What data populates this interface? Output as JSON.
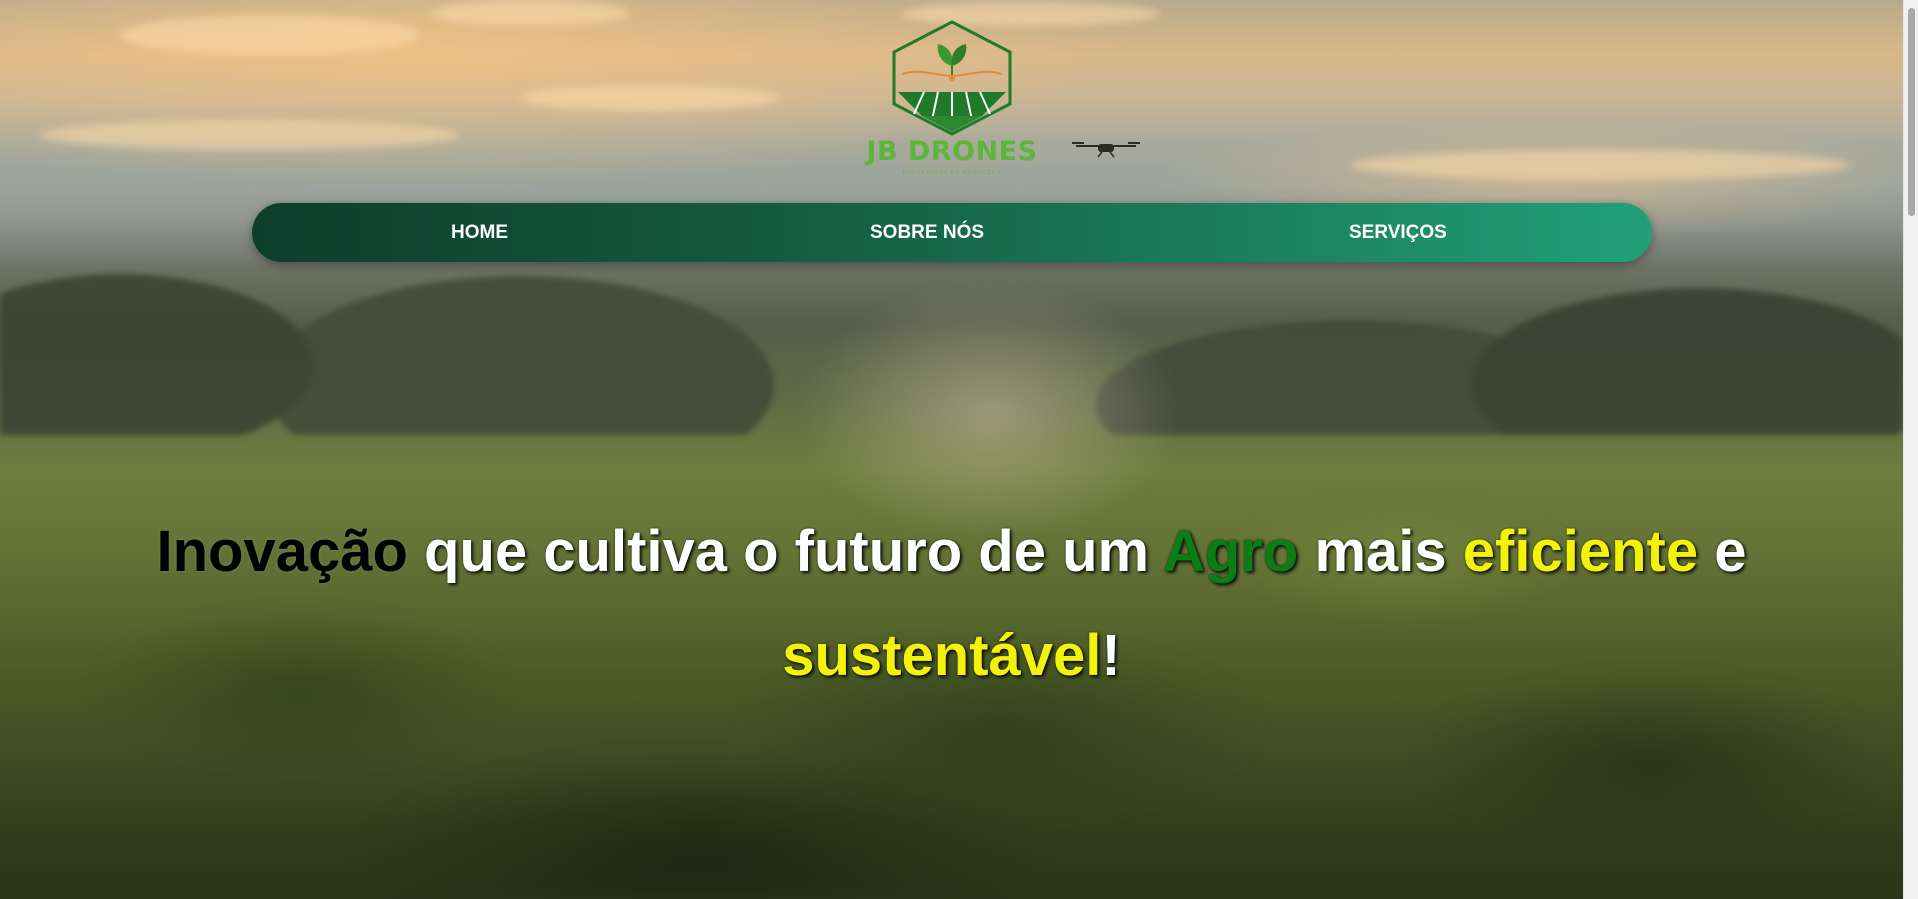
{
  "logo": {
    "name": "JB DRONES",
    "tagline": "PULVERIZAÇÃO AGRÍCOLA",
    "icon": "drone-leaf-field-icon",
    "color": "#5fb43a"
  },
  "nav": {
    "items": [
      {
        "label": "HOME"
      },
      {
        "label": "SOBRE NÓS"
      },
      {
        "label": "SERVIÇOS"
      }
    ],
    "gradient_start": "#0e3d2c",
    "gradient_end": "#21a178"
  },
  "headline": {
    "parts": {
      "inovacao": "Inovação",
      "text1": " que cultiva o futuro de um ",
      "agro": "Agro",
      "text2": " mais ",
      "eficiente": "eficiente",
      "text3": " e ",
      "sustentavel": "sustentável",
      "end": "!"
    },
    "colors": {
      "black": "#000000",
      "green": "#0b7d17",
      "yellow": "#f3f20a",
      "white": "#ffffff"
    }
  },
  "background": {
    "icon": "hero-field-photo"
  }
}
